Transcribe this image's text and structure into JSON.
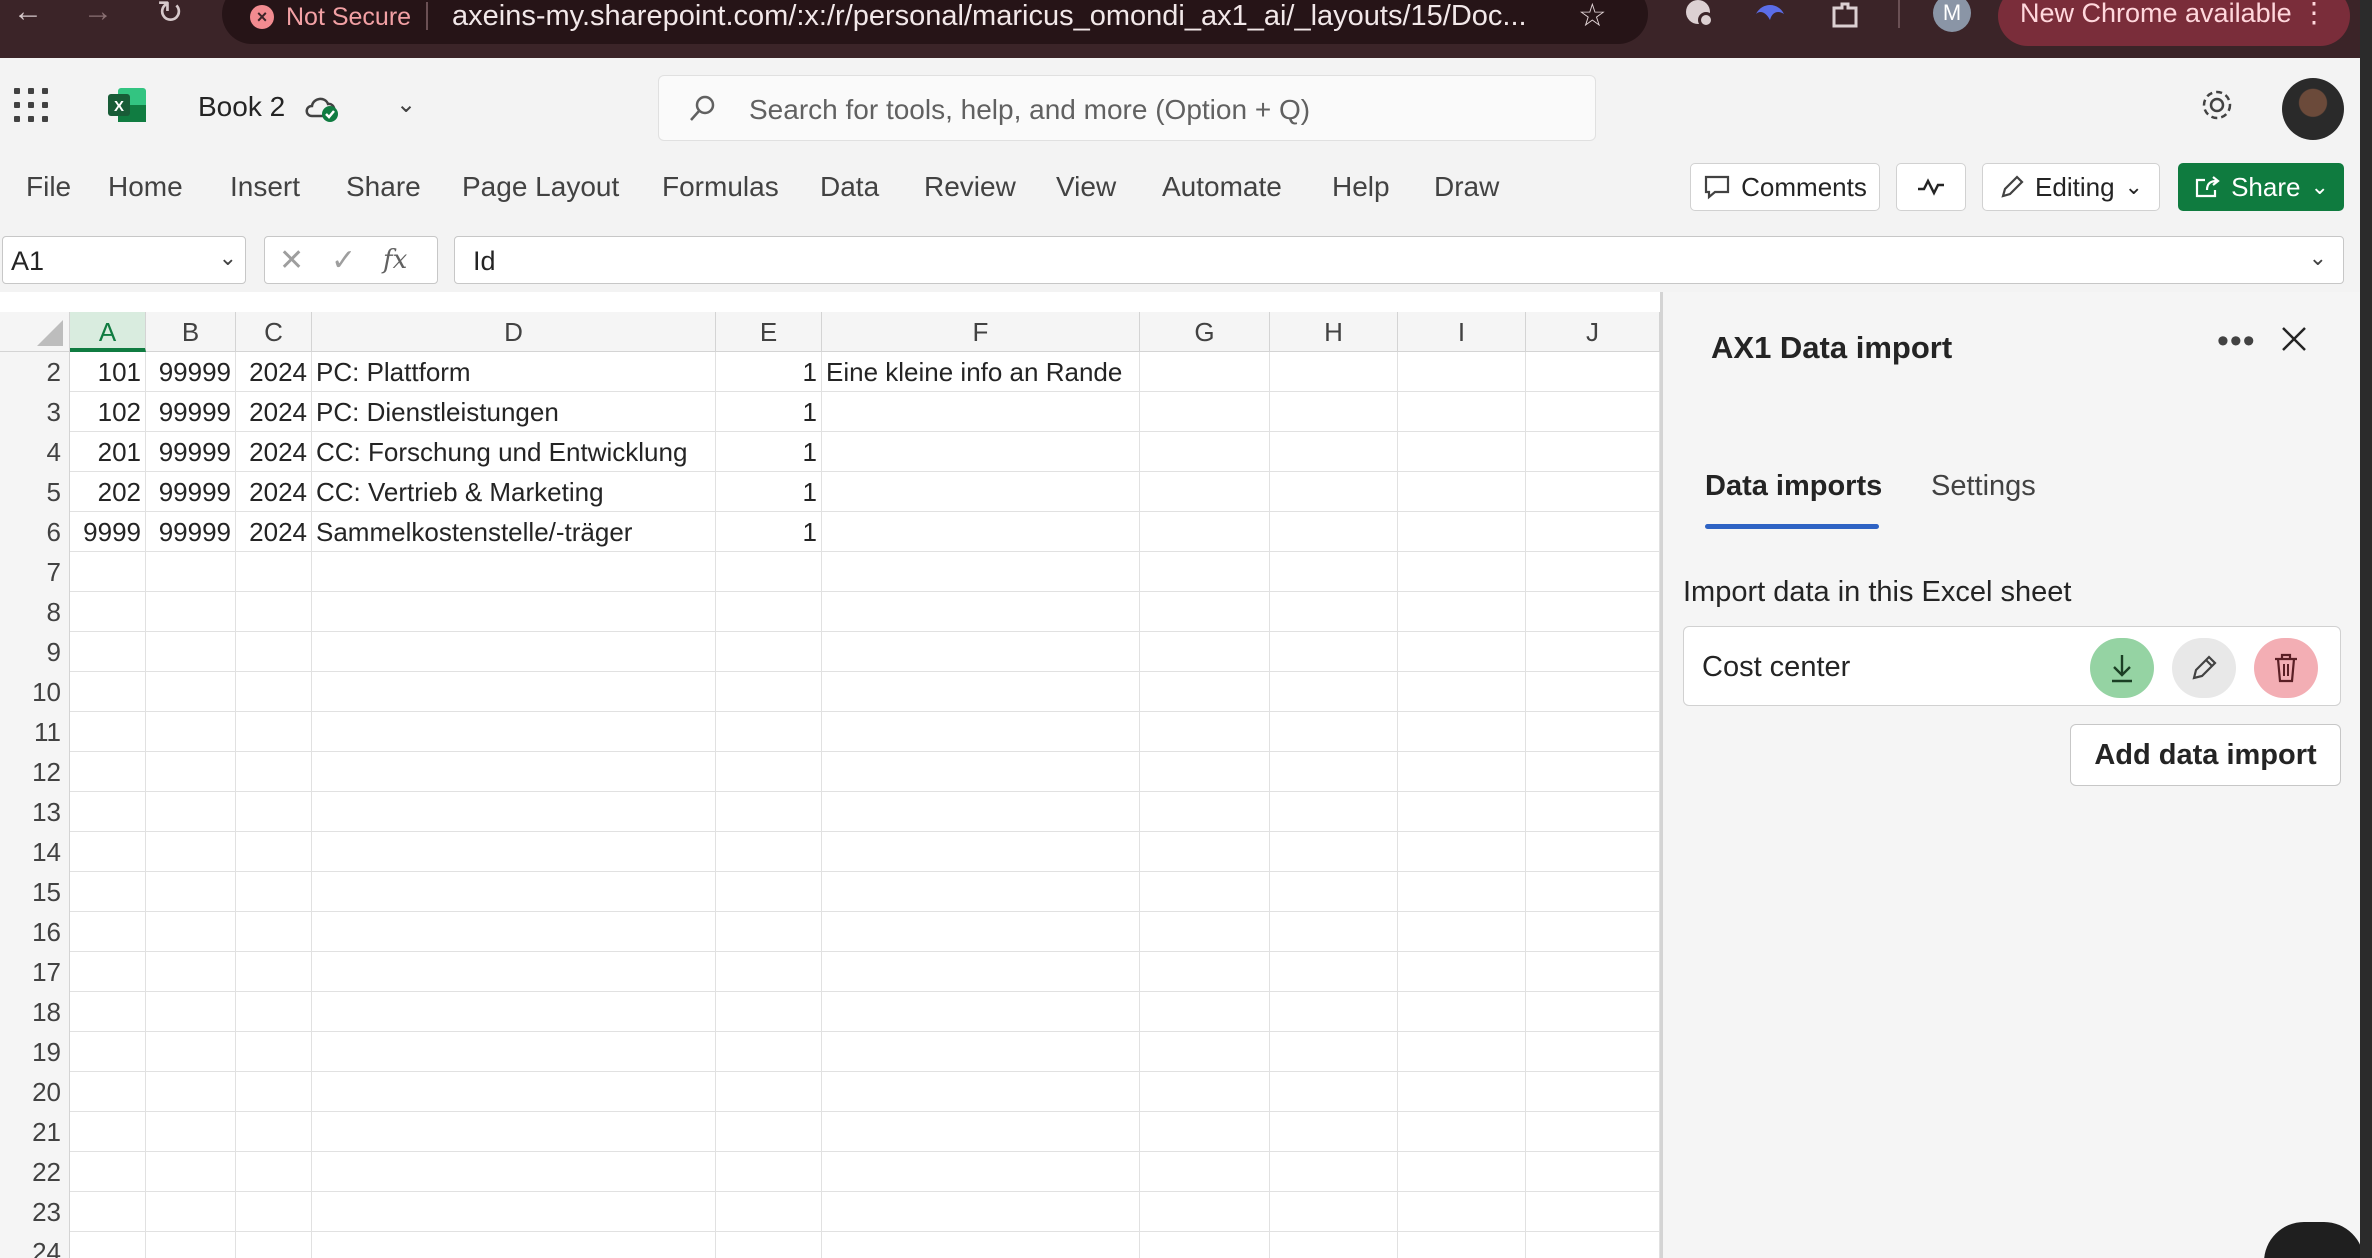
{
  "browser": {
    "security_label": "Not Secure",
    "url": "axeins-my.sharepoint.com/:x:/r/personal/maricus_omondi_ax1_ai/_layouts/15/Doc...",
    "profile_initial": "M",
    "update_label": "New Chrome available"
  },
  "app": {
    "doc_title": "Book 2",
    "search_placeholder": "Search for tools, help, and more (Option + Q)"
  },
  "ribbon": {
    "tabs": [
      "File",
      "Home",
      "Insert",
      "Share",
      "Page Layout",
      "Formulas",
      "Data",
      "Review",
      "View",
      "Automate",
      "Help",
      "Draw"
    ],
    "comments_label": "Comments",
    "editing_label": "Editing",
    "share_label": "Share"
  },
  "formula_bar": {
    "name_box": "A1",
    "fx_label": "fx",
    "value": "Id"
  },
  "grid": {
    "columns": [
      "A",
      "B",
      "C",
      "D",
      "E",
      "F",
      "G",
      "H",
      "I",
      "J"
    ],
    "active_column": "A",
    "row_numbers": [
      "2",
      "3",
      "4",
      "5",
      "6",
      "7",
      "8",
      "9",
      "10",
      "11",
      "12",
      "13",
      "14",
      "15",
      "16",
      "17",
      "18",
      "19",
      "20",
      "21",
      "22",
      "23",
      "24"
    ],
    "rows": [
      {
        "A": "101",
        "B": "99999",
        "C": "2024",
        "D": "PC: Plattform",
        "E": "1",
        "F": "Eine kleine info an Rande"
      },
      {
        "A": "102",
        "B": "99999",
        "C": "2024",
        "D": "PC: Dienstleistungen",
        "E": "1",
        "F": ""
      },
      {
        "A": "201",
        "B": "99999",
        "C": "2024",
        "D": "CC: Forschung und Entwicklung",
        "E": "1",
        "F": ""
      },
      {
        "A": "202",
        "B": "99999",
        "C": "2024",
        "D": "CC: Vertrieb & Marketing",
        "E": "1",
        "F": ""
      },
      {
        "A": "9999",
        "B": "99999",
        "C": "2024",
        "D": "Sammelkostenstelle/-träger",
        "E": "1",
        "F": ""
      }
    ]
  },
  "task_pane": {
    "title": "AX1 Data import",
    "tabs": [
      "Data imports",
      "Settings"
    ],
    "active_tab": "Data imports",
    "import_heading": "Import data in this Excel sheet",
    "imports": [
      {
        "label": "Cost center"
      }
    ],
    "add_button_label": "Add data import"
  },
  "colors": {
    "excel_green": "#107c41",
    "share_green": "#0f7b3f",
    "tab_underline": "#2e63c4",
    "download_bg": "#95d3a3",
    "delete_bg": "#f3aeb4"
  }
}
